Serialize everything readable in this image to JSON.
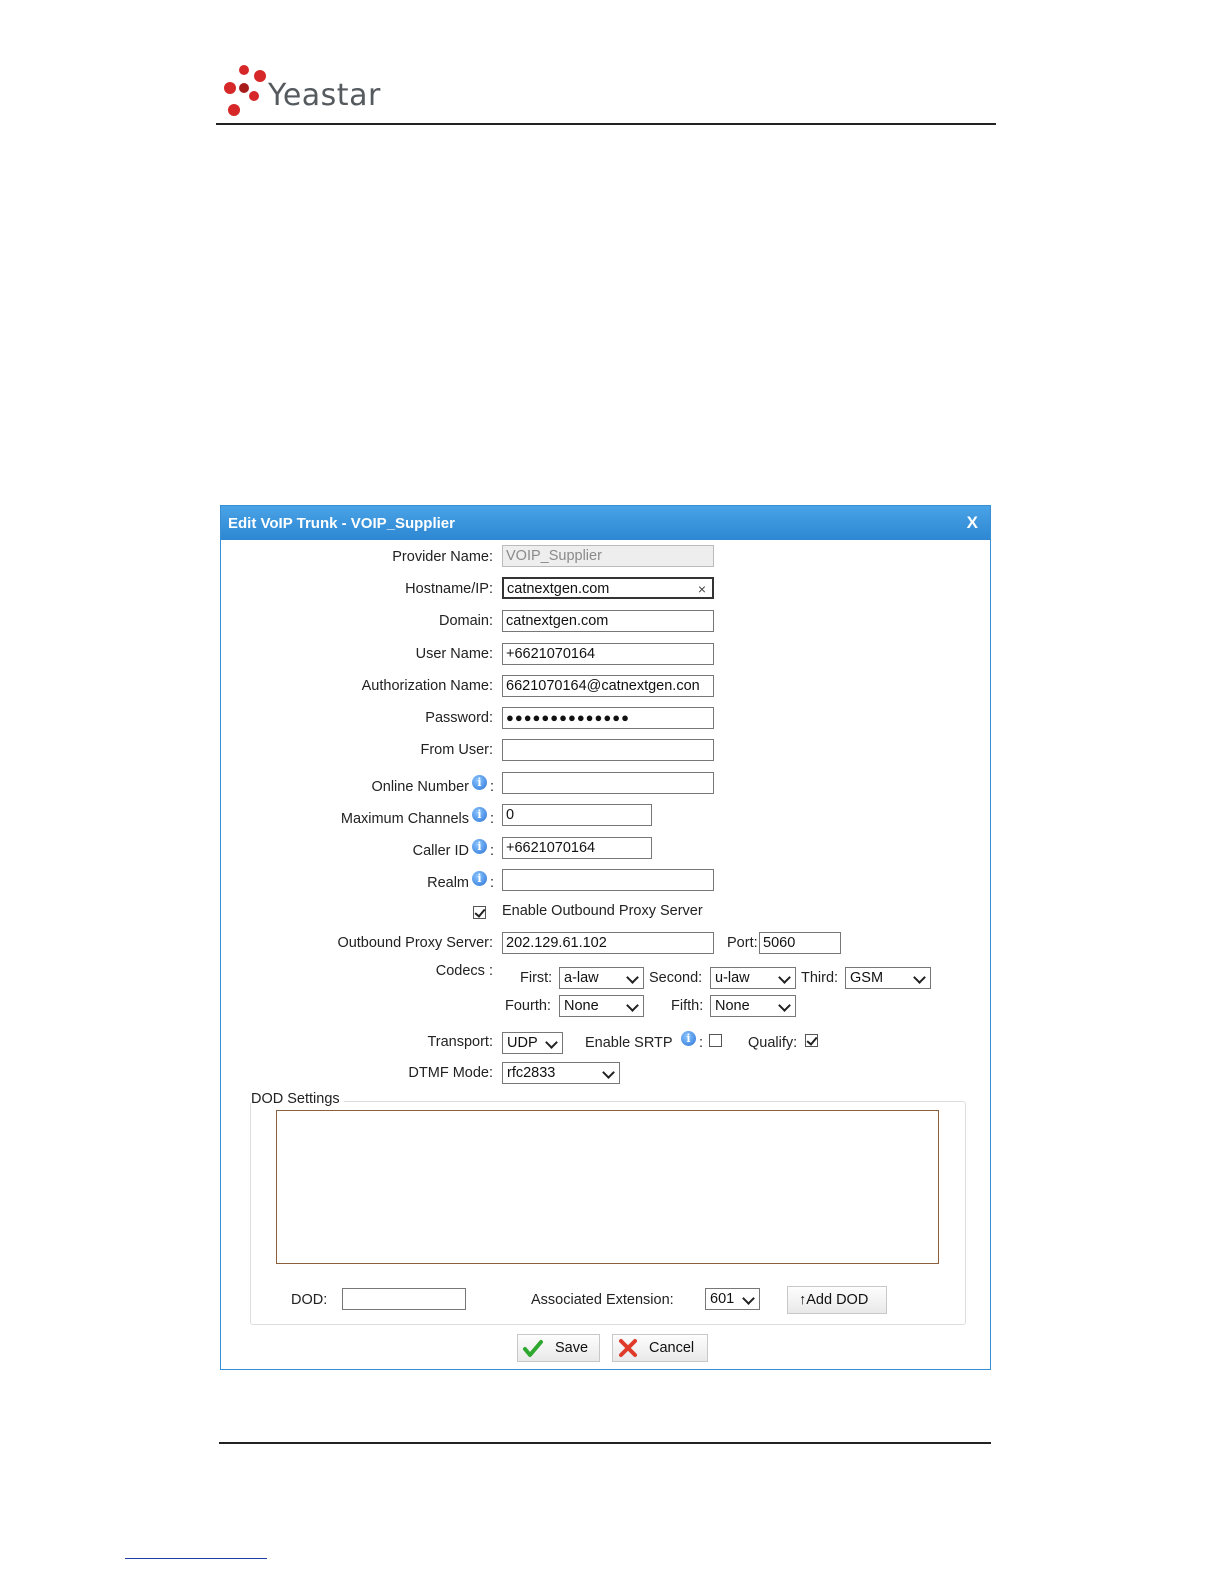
{
  "brand": {
    "name": "Yeastar"
  },
  "dialog": {
    "title": "Edit VoIP Trunk - VOIP_Supplier",
    "close_label": "X",
    "fields": {
      "provider_name": {
        "label": "Provider Name:",
        "value": "VOIP_Supplier"
      },
      "hostname": {
        "label": "Hostname/IP:",
        "value": "catnextgen.com",
        "clear": "×"
      },
      "domain": {
        "label": "Domain:",
        "value": "catnextgen.com"
      },
      "user_name": {
        "label": "User Name:",
        "value": "+6621070164"
      },
      "authorization_name": {
        "label": "Authorization Name:",
        "value": "6621070164@catnextgen.con"
      },
      "password": {
        "label": "Password:",
        "value": "●●●●●●●●●●●●●●"
      },
      "from_user": {
        "label": "From User:",
        "value": ""
      },
      "online_number": {
        "label": "Online Number",
        "value": ""
      },
      "maximum_channels": {
        "label": "Maximum Channels",
        "value": "0"
      },
      "caller_id": {
        "label": "Caller ID",
        "value": "+6621070164"
      },
      "realm": {
        "label": "Realm",
        "value": ""
      }
    },
    "colon": ":",
    "info_glyph": "i",
    "outbound_proxy": {
      "enable_label": "Enable Outbound Proxy Server",
      "enabled": true,
      "server_label": "Outbound Proxy Server:",
      "server_value": "202.129.61.102",
      "port_label": "Port:",
      "port_value": "5060"
    },
    "codecs": {
      "label": "Codecs :",
      "first_label": "First:",
      "first": "a-law",
      "second_label": "Second:",
      "second": "u-law",
      "third_label": "Third:",
      "third": "GSM",
      "fourth_label": "Fourth:",
      "fourth": "None",
      "fifth_label": "Fifth:",
      "fifth": "None"
    },
    "transport": {
      "label": "Transport:",
      "value": "UDP"
    },
    "srtp": {
      "label": "Enable SRTP",
      "enabled": false
    },
    "qualify": {
      "label": "Qualify:",
      "enabled": true
    },
    "dtmf": {
      "label": "DTMF Mode:",
      "value": "rfc2833"
    },
    "dod": {
      "legend": "DOD Settings",
      "dod_label": "DOD:",
      "dod_value": "",
      "assoc_label": "Associated Extension:",
      "assoc_value": "601",
      "add_button": "↑Add DOD"
    },
    "buttons": {
      "save": "Save",
      "cancel": "Cancel"
    },
    "colors": {
      "title_bar": "#2d87d2",
      "border": "#3a8fd4",
      "save_check": "#2fa82f",
      "cancel_x": "#e03a2a"
    }
  }
}
